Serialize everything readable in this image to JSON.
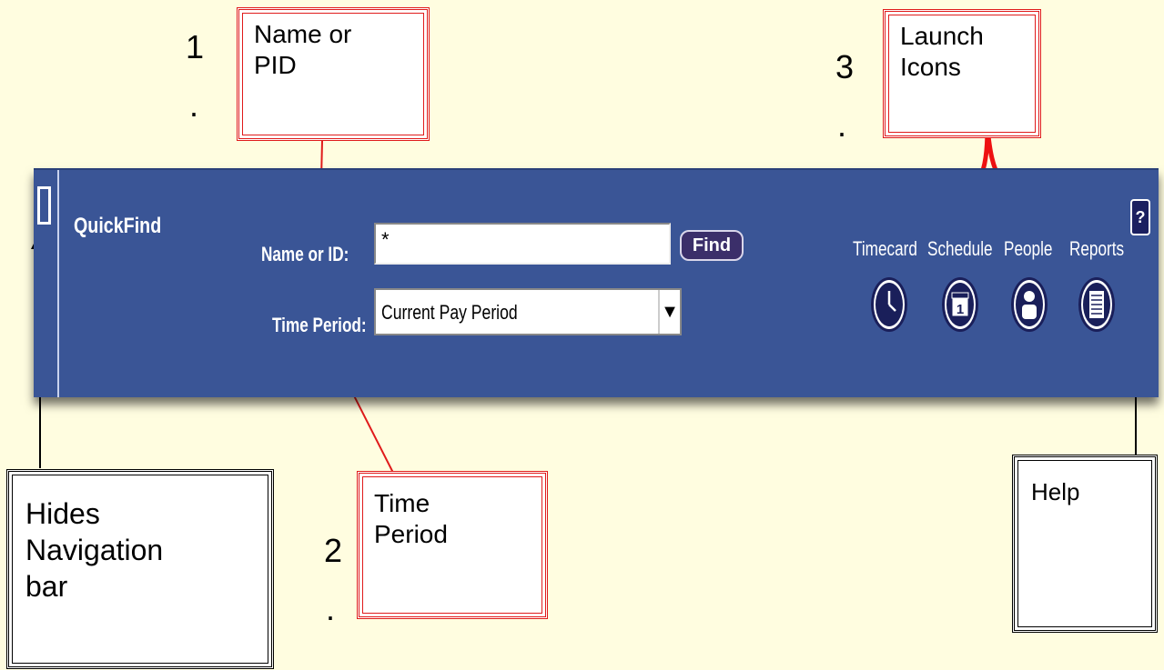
{
  "steps": {
    "one": "1",
    "two": "2",
    "three": "3",
    "dot": "."
  },
  "callouts": {
    "name_or_pid": [
      "Name or",
      "PID"
    ],
    "launch_icons": [
      "Launch",
      "Icons"
    ],
    "time_period": [
      "Time",
      "Period"
    ],
    "hides_nav": [
      "Hides",
      "Navigation",
      "bar"
    ],
    "help": "Help"
  },
  "quickfind": {
    "title": "QuickFind",
    "name_label": "Name or ID:",
    "name_value": "*",
    "find_label": "Find",
    "period_label": "Time Period:",
    "period_value": "Current Pay Period",
    "dropdown_glyph": "▼",
    "help_glyph": "?",
    "launch": [
      {
        "label": "Timecard",
        "icon": "clock-icon"
      },
      {
        "label": "Schedule",
        "icon": "calendar-icon"
      },
      {
        "label": "People",
        "icon": "person-icon"
      },
      {
        "label": "Reports",
        "icon": "report-icon"
      }
    ]
  },
  "colors": {
    "background": "#fffde0",
    "bar": "#3a5596",
    "callout_red": "#e01b1b"
  }
}
